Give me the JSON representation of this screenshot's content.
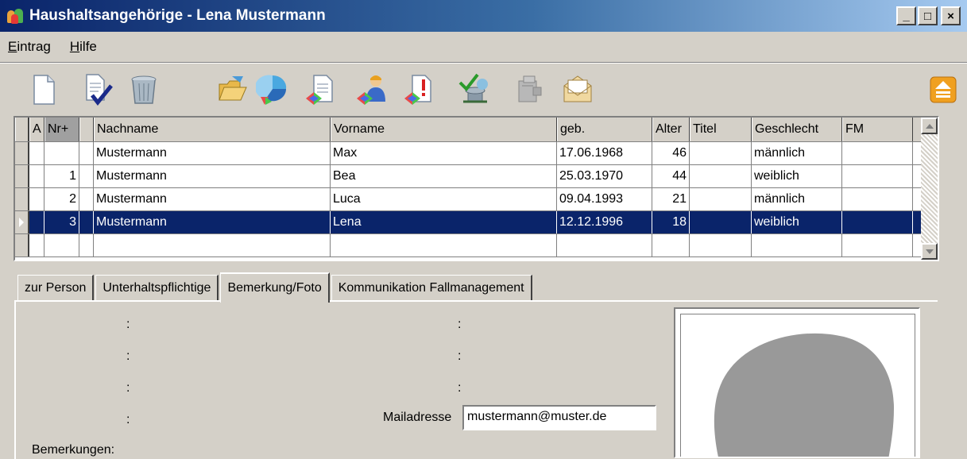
{
  "window": {
    "title": "Haushaltsangehörige - Lena Mustermann",
    "buttons": {
      "minimize": "_",
      "maximize": "□",
      "close": "×"
    }
  },
  "menu": [
    "Eintrag",
    "Hilfe"
  ],
  "toolbar": {
    "icons": [
      "new-document-icon",
      "confirm-document-icon",
      "trash-bin-icon",
      "open-folder-icon",
      "pie-chart-icon",
      "document-colors-icon",
      "person-colors-icon",
      "document-alert-icon",
      "network-check-icon",
      "machine-icon",
      "envelope-icon",
      "scroll-up-icon"
    ]
  },
  "grid": {
    "columns": {
      "a": "A",
      "nr": "Nr+",
      "nachname": "Nachname",
      "vorname": "Vorname",
      "geb": "geb.",
      "alter": "Alter",
      "titel": "Titel",
      "geschlecht": "Geschlecht",
      "fm": "FM"
    },
    "rows": [
      {
        "nr": "",
        "nachname": "Mustermann",
        "vorname": "Max",
        "geb": "17.06.1968",
        "alter": "46",
        "titel": "",
        "geschlecht": "männlich",
        "fm": ""
      },
      {
        "nr": "1",
        "nachname": "Mustermann",
        "vorname": "Bea",
        "geb": "25.03.1970",
        "alter": "44",
        "titel": "",
        "geschlecht": "weiblich",
        "fm": ""
      },
      {
        "nr": "2",
        "nachname": "Mustermann",
        "vorname": "Luca",
        "geb": "09.04.1993",
        "alter": "21",
        "titel": "",
        "geschlecht": "männlich",
        "fm": ""
      },
      {
        "nr": "3",
        "nachname": "Mustermann",
        "vorname": "Lena",
        "geb": "12.12.1996",
        "alter": "18",
        "titel": "",
        "geschlecht": "weiblich",
        "fm": ""
      }
    ],
    "selected_row": 3
  },
  "tabs": [
    "zur Person",
    "Unterhaltspflichtige",
    "Bemerkung/Foto",
    "Kommunikation Fallmanagement"
  ],
  "active_tab": "Bemerkung/Foto",
  "form": {
    "colon": ":",
    "mail_label": "Mailadresse",
    "mail_value": "mustermann@muster.de",
    "bemerkungen_label": "Bemerkungen:"
  },
  "colors": {
    "selection": "#0a246a",
    "face": "#d4d0c8",
    "photo_silhouette": "#999999"
  }
}
